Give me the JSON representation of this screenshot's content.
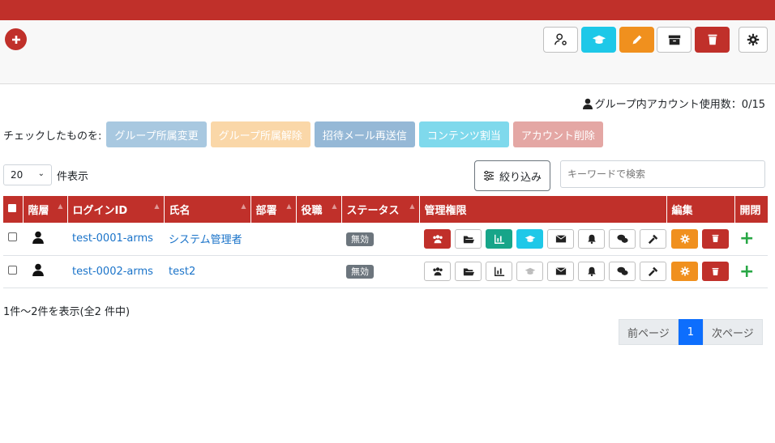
{
  "toolbar": {
    "add_icon": "plus-circle-icon",
    "buttons": [
      {
        "name": "user-settings",
        "icon": "user-gear-icon",
        "bg": "#ffffff",
        "fg": "#222"
      },
      {
        "name": "course",
        "icon": "graduation-cap-icon",
        "bg": "#1ec8e8",
        "fg": "#fff"
      },
      {
        "name": "edit",
        "icon": "pencil-icon",
        "bg": "#f0901e",
        "fg": "#fff"
      },
      {
        "name": "archive",
        "icon": "archive-icon",
        "bg": "#ffffff",
        "fg": "#222"
      },
      {
        "name": "delete",
        "icon": "trash-icon",
        "bg": "#c0302a",
        "fg": "#fff"
      },
      {
        "name": "settings",
        "icon": "gear-icon",
        "bg": "#ffffff",
        "fg": "#222"
      }
    ]
  },
  "usage": {
    "text": "グループ内アカウント使用数：0/15"
  },
  "bulk": {
    "label": "チェックしたものを:",
    "actions": [
      {
        "label": "グループ所属変更",
        "color": "#a8c8e0"
      },
      {
        "label": "グループ所属解除",
        "color": "#fad7a8"
      },
      {
        "label": "招待メール再送信",
        "color": "#95b8d6"
      },
      {
        "label": "コンテンツ割当",
        "color": "#7fd9ec"
      },
      {
        "label": "アカウント削除",
        "color": "#e4a7a4"
      }
    ]
  },
  "perpage": {
    "value": "20",
    "suffix": "件表示"
  },
  "filter": {
    "label": "絞り込み"
  },
  "search": {
    "placeholder": "キーワードで検索"
  },
  "table": {
    "headers": [
      "",
      "階層",
      "ログインID",
      "氏名",
      "部署",
      "役職",
      "ステータス",
      "管理権限",
      "",
      "編集",
      "開閉"
    ],
    "rows": [
      {
        "login": "test-0001-arms",
        "name": "システム管理者",
        "dept": "",
        "role": "",
        "status": "無効",
        "active_perms": [
          true,
          false,
          true,
          true,
          false,
          false,
          false,
          false
        ]
      },
      {
        "login": "test-0002-arms",
        "name": "test2",
        "dept": "",
        "role": "",
        "status": "無効",
        "active_perms": [
          false,
          false,
          false,
          false,
          false,
          false,
          false,
          false
        ]
      }
    ]
  },
  "summary": "1件～2件を表示(全2 件中)",
  "pager": {
    "prev": "前ページ",
    "current": "1",
    "next": "次ページ"
  }
}
